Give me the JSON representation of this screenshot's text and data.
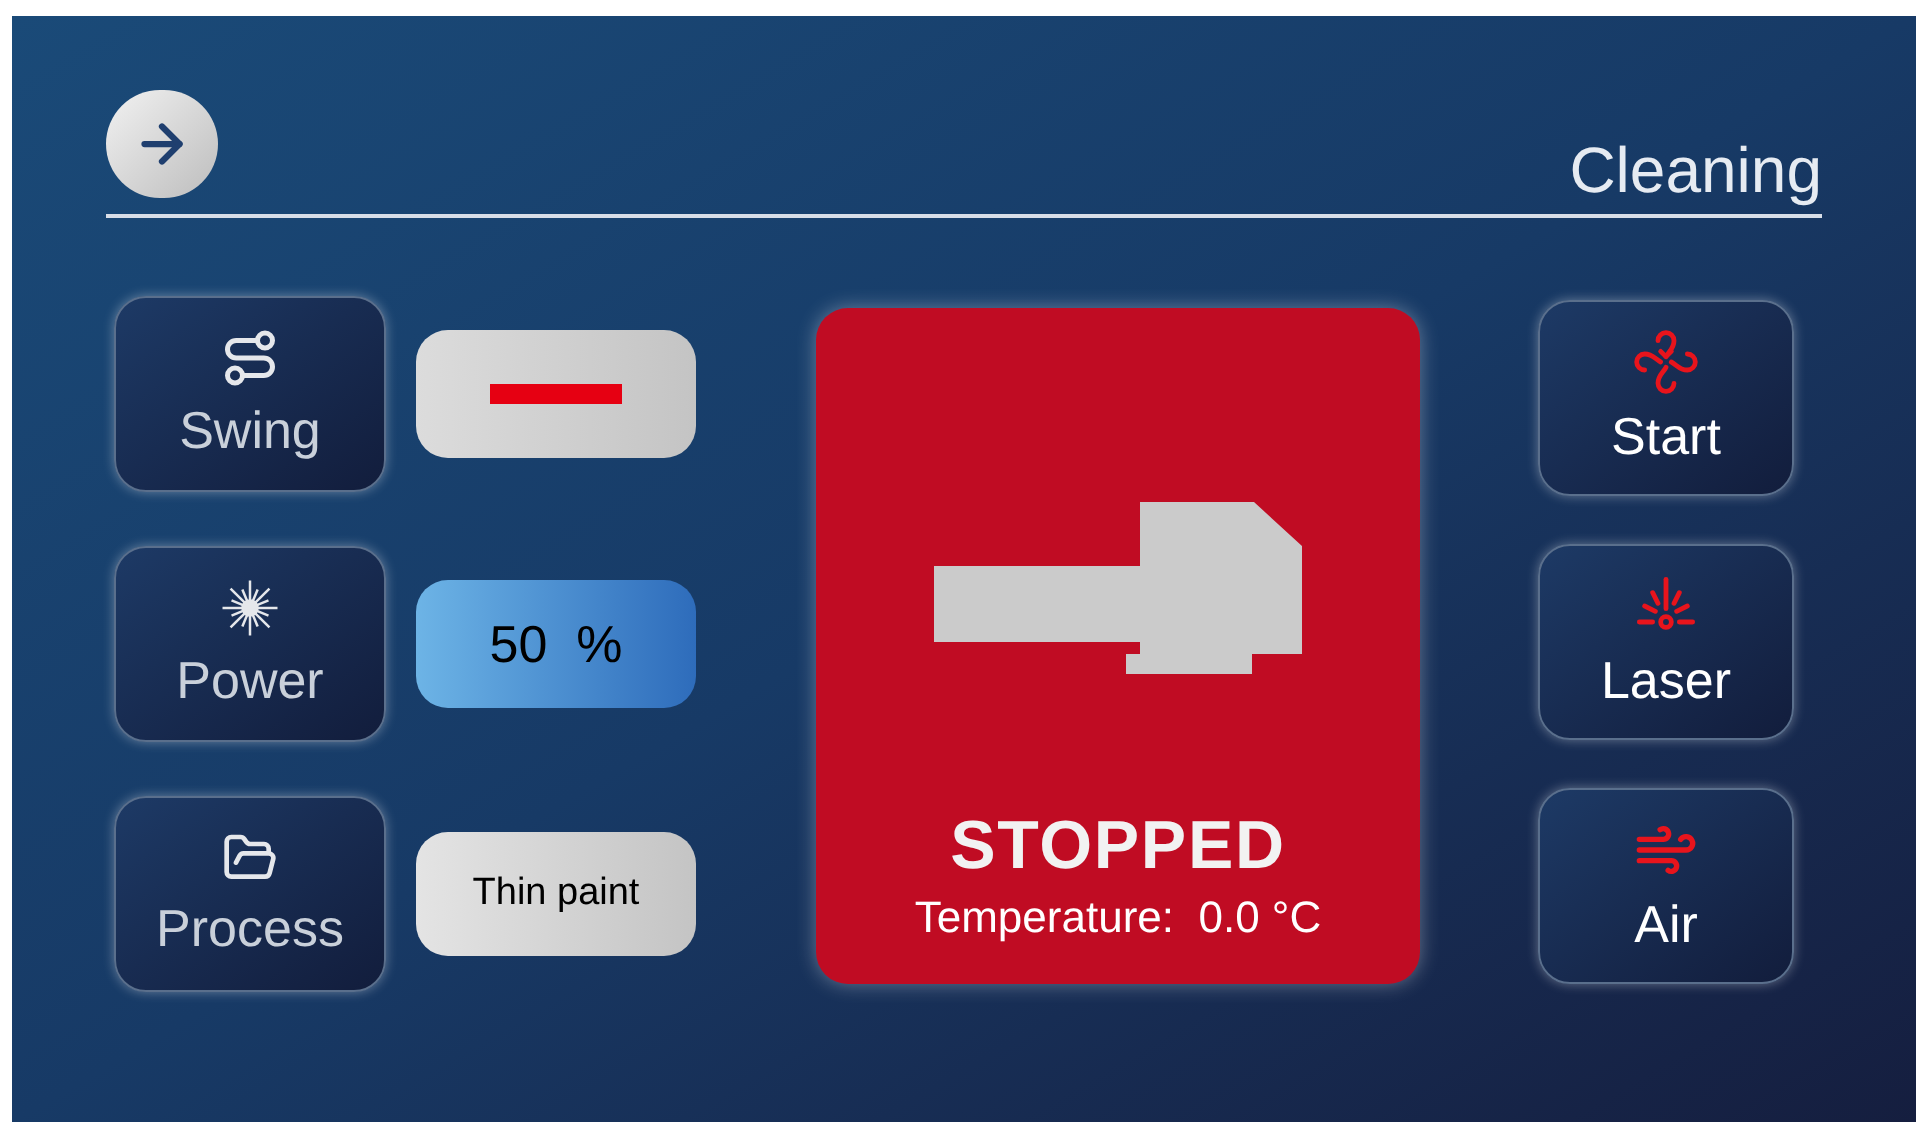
{
  "header": {
    "title": "Cleaning"
  },
  "settings": [
    {
      "kind": "swing",
      "label": "Swing",
      "on": false
    },
    {
      "kind": "power",
      "label": "Power",
      "value": "50  %",
      "highlighted": true
    },
    {
      "kind": "process",
      "label": "Process",
      "value": "Thin paint",
      "highlighted": false
    }
  ],
  "status": {
    "running": false,
    "state": "STOPPED",
    "temperature": "Temperature:  0.0 °C"
  },
  "actions": [
    {
      "kind": "start",
      "label": "Start"
    },
    {
      "kind": "laser",
      "label": "Laser"
    },
    {
      "kind": "air",
      "label": "Air"
    }
  ]
}
